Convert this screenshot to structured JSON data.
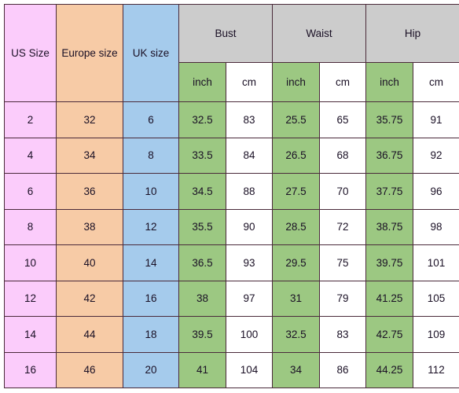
{
  "table": {
    "name": "womens-size-chart",
    "headers": {
      "us_size": "US Size",
      "europe_size": "Europe size",
      "uk_size": "UK size",
      "bust": "Bust",
      "waist": "Waist",
      "hip": "Hip"
    },
    "unit_row": {
      "bust_inch": "inch",
      "bust_cm": "cm",
      "waist_inch": "inch",
      "waist_cm": "cm",
      "hip_inch": "inch",
      "hip_cm": "cm"
    },
    "columns": [
      "US Size",
      "Europe size",
      "UK size",
      "Bust inch",
      "Bust cm",
      "Waist inch",
      "Waist cm",
      "Hip inch",
      "Hip cm"
    ],
    "rows": [
      {
        "us": "2",
        "eu": "32",
        "uk": "6",
        "bust_in": "32.5",
        "bust_cm": "83",
        "waist_in": "25.5",
        "waist_cm": "65",
        "hip_in": "35.75",
        "hip_cm": "91"
      },
      {
        "us": "4",
        "eu": "34",
        "uk": "8",
        "bust_in": "33.5",
        "bust_cm": "84",
        "waist_in": "26.5",
        "waist_cm": "68",
        "hip_in": "36.75",
        "hip_cm": "92"
      },
      {
        "us": "6",
        "eu": "36",
        "uk": "10",
        "bust_in": "34.5",
        "bust_cm": "88",
        "waist_in": "27.5",
        "waist_cm": "70",
        "hip_in": "37.75",
        "hip_cm": "96"
      },
      {
        "us": "8",
        "eu": "38",
        "uk": "12",
        "bust_in": "35.5",
        "bust_cm": "90",
        "waist_in": "28.5",
        "waist_cm": "72",
        "hip_in": "38.75",
        "hip_cm": "98"
      },
      {
        "us": "10",
        "eu": "40",
        "uk": "14",
        "bust_in": "36.5",
        "bust_cm": "93",
        "waist_in": "29.5",
        "waist_cm": "75",
        "hip_in": "39.75",
        "hip_cm": "101"
      },
      {
        "us": "12",
        "eu": "42",
        "uk": "16",
        "bust_in": "38",
        "bust_cm": "97",
        "waist_in": "31",
        "waist_cm": "79",
        "hip_in": "41.25",
        "hip_cm": "105"
      },
      {
        "us": "14",
        "eu": "44",
        "uk": "18",
        "bust_in": "39.5",
        "bust_cm": "100",
        "waist_in": "32.5",
        "waist_cm": "83",
        "hip_in": "42.75",
        "hip_cm": "109"
      },
      {
        "us": "16",
        "eu": "46",
        "uk": "20",
        "bust_in": "41",
        "bust_cm": "104",
        "waist_in": "34",
        "waist_cm": "86",
        "hip_in": "44.25",
        "hip_cm": "112"
      }
    ]
  },
  "colors": {
    "us_size": "#FBCCFB",
    "europe_size": "#F7CBA6",
    "uk_size": "#A5CBEC",
    "measure_header": "#CCCCCC",
    "inch_cell": "#9CC882",
    "cm_cell": "#FFFFFF",
    "border": "#4A2A3A",
    "text": "#1A1025"
  }
}
